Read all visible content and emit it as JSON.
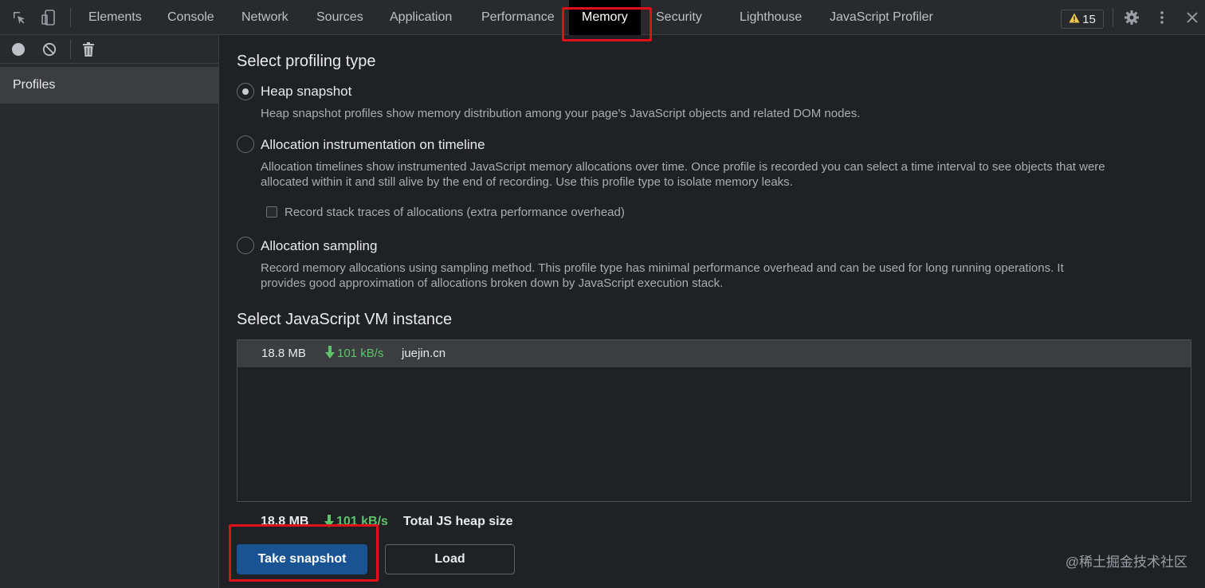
{
  "toolbar": {
    "tabs": [
      "Elements",
      "Console",
      "Network",
      "Sources",
      "Application",
      "Performance",
      "Memory",
      "Security",
      "Lighthouse",
      "JavaScript Profiler"
    ],
    "active_tab": "Memory",
    "warning_count": "15"
  },
  "sidebar": {
    "items": [
      {
        "label": "Profiles"
      }
    ]
  },
  "main": {
    "profiling_title": "Select profiling type",
    "options": [
      {
        "label": "Heap snapshot",
        "description": "Heap snapshot profiles show memory distribution among your page's JavaScript objects and related DOM nodes.",
        "checked": true
      },
      {
        "label": "Allocation instrumentation on timeline",
        "description_line1": "Allocation timelines show instrumented JavaScript memory allocations over time. Once profile is recorded you can select a time interval to see objects that were",
        "description_line2": "allocated within it and still alive by the end of recording. Use this profile type to isolate memory leaks.",
        "checkbox_label": "Record stack traces of allocations (extra performance overhead)"
      },
      {
        "label": "Allocation sampling",
        "description_line1": "Record memory allocations using sampling method. This profile type has minimal performance overhead and can be used for long running operations. It",
        "description_line2": "provides good approximation of allocations broken down by JavaScript execution stack."
      }
    ],
    "vm_title": "Select JavaScript VM instance",
    "vm_instances": [
      {
        "size": "18.8 MB",
        "rate": "101 kB/s",
        "name": "juejin.cn"
      }
    ],
    "total": {
      "size": "18.8 MB",
      "rate": "101 kB/s",
      "label": "Total JS heap size"
    },
    "take_snapshot_label": "Take snapshot",
    "load_label": "Load"
  },
  "watermark": "@稀土掘金技术社区",
  "colors": {
    "accent_highlight": "#e0101a",
    "primary_button": "#1a5394",
    "rate_green": "#5cc36a"
  }
}
